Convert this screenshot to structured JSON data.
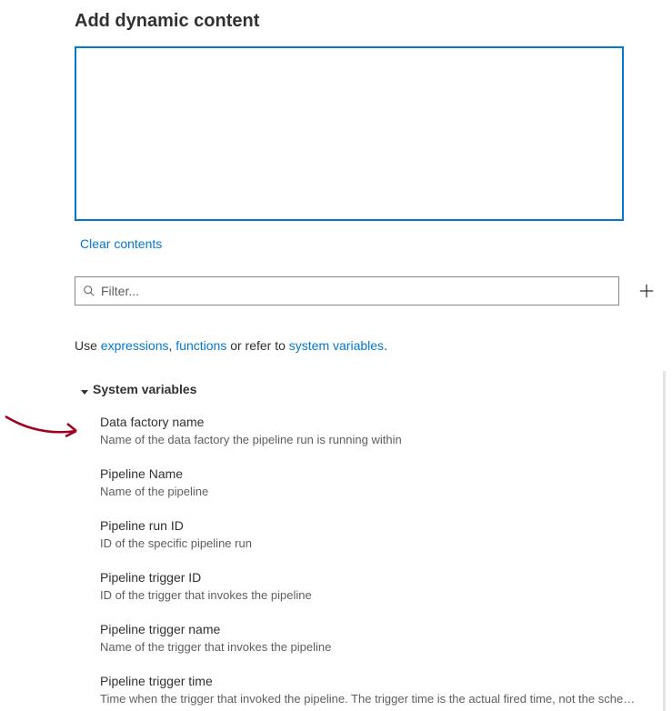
{
  "title": "Add dynamic content",
  "expression_value": "",
  "clear_label": "Clear contents",
  "filter": {
    "placeholder": "Filter..."
  },
  "help": {
    "prefix": "Use ",
    "link1": "expressions",
    "comma": ", ",
    "link2": "functions",
    "mid": " or refer to ",
    "link3": "system variables",
    "suffix": "."
  },
  "section": {
    "label": "System variables"
  },
  "variables": [
    {
      "name": "Data factory name",
      "desc": "Name of the data factory the pipeline run is running within"
    },
    {
      "name": "Pipeline Name",
      "desc": "Name of the pipeline"
    },
    {
      "name": "Pipeline run ID",
      "desc": "ID of the specific pipeline run"
    },
    {
      "name": "Pipeline trigger ID",
      "desc": "ID of the trigger that invokes the pipeline"
    },
    {
      "name": "Pipeline trigger name",
      "desc": "Name of the trigger that invokes the pipeline"
    },
    {
      "name": "Pipeline trigger time",
      "desc": "Time when the trigger that invoked the pipeline. The trigger time is the actual fired time, not the scheduled time."
    }
  ]
}
